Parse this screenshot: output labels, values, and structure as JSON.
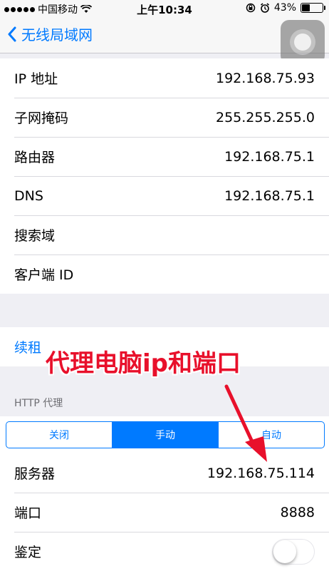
{
  "status_bar": {
    "carrier": "中国移动",
    "time": "上午10:34",
    "battery_percent": "43%",
    "battery_level": 0.43
  },
  "nav": {
    "back_label": "无线局域网"
  },
  "network_info": [
    {
      "label": "IP 地址",
      "value": "192.168.75.93"
    },
    {
      "label": "子网掩码",
      "value": "255.255.255.0"
    },
    {
      "label": "路由器",
      "value": "192.168.75.1"
    },
    {
      "label": "DNS",
      "value": "192.168.75.1"
    },
    {
      "label": "搜索域",
      "value": ""
    },
    {
      "label": "客户端 ID",
      "value": ""
    }
  ],
  "renew": {
    "label": "续租"
  },
  "http_proxy": {
    "section_title": "HTTP 代理",
    "segments": [
      "关闭",
      "手动",
      "自动"
    ],
    "selected": "手动",
    "rows": [
      {
        "label": "服务器",
        "value": "192.168.75.114"
      },
      {
        "label": "端口",
        "value": "8888"
      },
      {
        "label": "鉴定",
        "toggle": false
      }
    ]
  },
  "annotation": {
    "text": "代理电脑ip和端口"
  },
  "colors": {
    "accent": "#007aff",
    "annotation_red": "#e8102b",
    "background": "#efeff4"
  }
}
